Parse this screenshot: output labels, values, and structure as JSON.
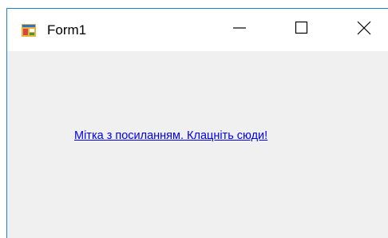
{
  "window": {
    "title": "Form1",
    "icon": "winforms-app-icon",
    "minimize_icon": "minimize-icon",
    "maximize_icon": "maximize-icon",
    "close_icon": "close-icon",
    "border_color": "#1883d7",
    "client_background": "#f0f0f0"
  },
  "form": {
    "link_label": "Мітка з посиланням. Клацніть сюди!",
    "link_color": "#0000ee"
  }
}
